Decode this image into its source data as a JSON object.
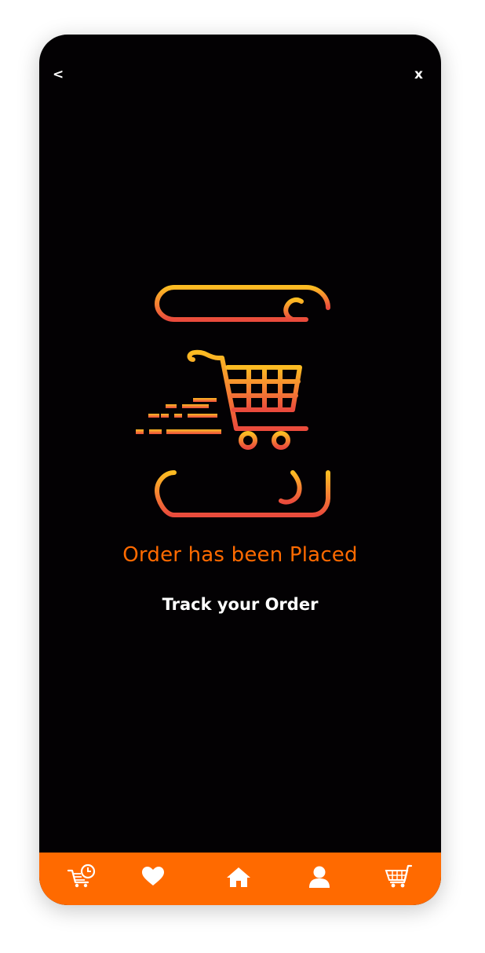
{
  "header": {
    "back_label": "<",
    "close_label": "x"
  },
  "confirmation": {
    "title": "Order has been Placed",
    "link": "Track your Order"
  },
  "bottom_nav": [
    {
      "name": "order-history",
      "icon": "cart-clock-icon"
    },
    {
      "name": "favorites",
      "icon": "heart-icon"
    },
    {
      "name": "home",
      "icon": "home-icon"
    },
    {
      "name": "profile",
      "icon": "user-icon"
    },
    {
      "name": "cart",
      "icon": "cart-icon"
    }
  ],
  "colors": {
    "accent": "#ff6a00",
    "background": "#030103",
    "gradient_top": "#fcbc22",
    "gradient_bottom": "#ea4b3c"
  }
}
